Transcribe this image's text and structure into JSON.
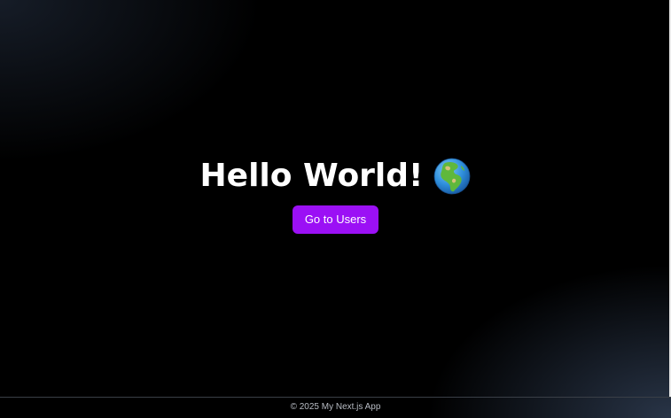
{
  "hero": {
    "title": "Hello World!",
    "title_icon": "globe-icon",
    "button_label": "Go to Users"
  },
  "footer": {
    "text": "© 2025 My Next.js App"
  },
  "colors": {
    "background": "#000000",
    "button": "#9b10f5",
    "title_text": "#ffffff",
    "footer_text": "#b8bcc4"
  }
}
